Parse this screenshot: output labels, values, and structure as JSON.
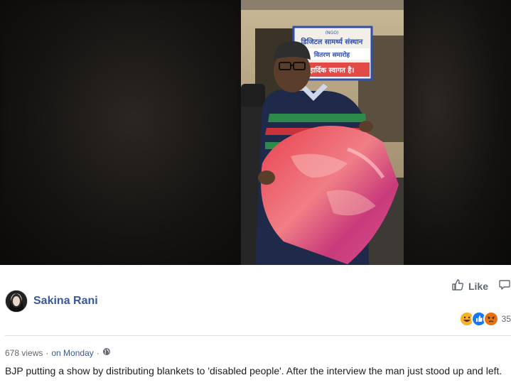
{
  "video": {
    "sign_lines": [
      "(NGO)",
      "डिजिटल सामर्थ्य संस्थान",
      "वितरण समारोह",
      "हार्दिक स्वागत है।"
    ]
  },
  "post": {
    "author": "Sakina Rani",
    "like_label": "Like",
    "reaction_count": "35",
    "views": "678 views",
    "separator": "·",
    "time": "on Monday",
    "description": "BJP putting a show by distributing blankets to 'disabled people'. After the interview the man just stood up and left."
  },
  "icons": {
    "like": "thumbs-up-icon",
    "comment": "comment-icon",
    "privacy": "globe-icon",
    "reactions": [
      "haha-reaction-icon",
      "like-reaction-icon",
      "angry-reaction-icon"
    ]
  },
  "colors": {
    "link": "#385898",
    "meta": "#606770",
    "like_reaction": "#1877f2",
    "angry_reaction": "#e9710f",
    "haha_reaction": "#f7b125"
  }
}
